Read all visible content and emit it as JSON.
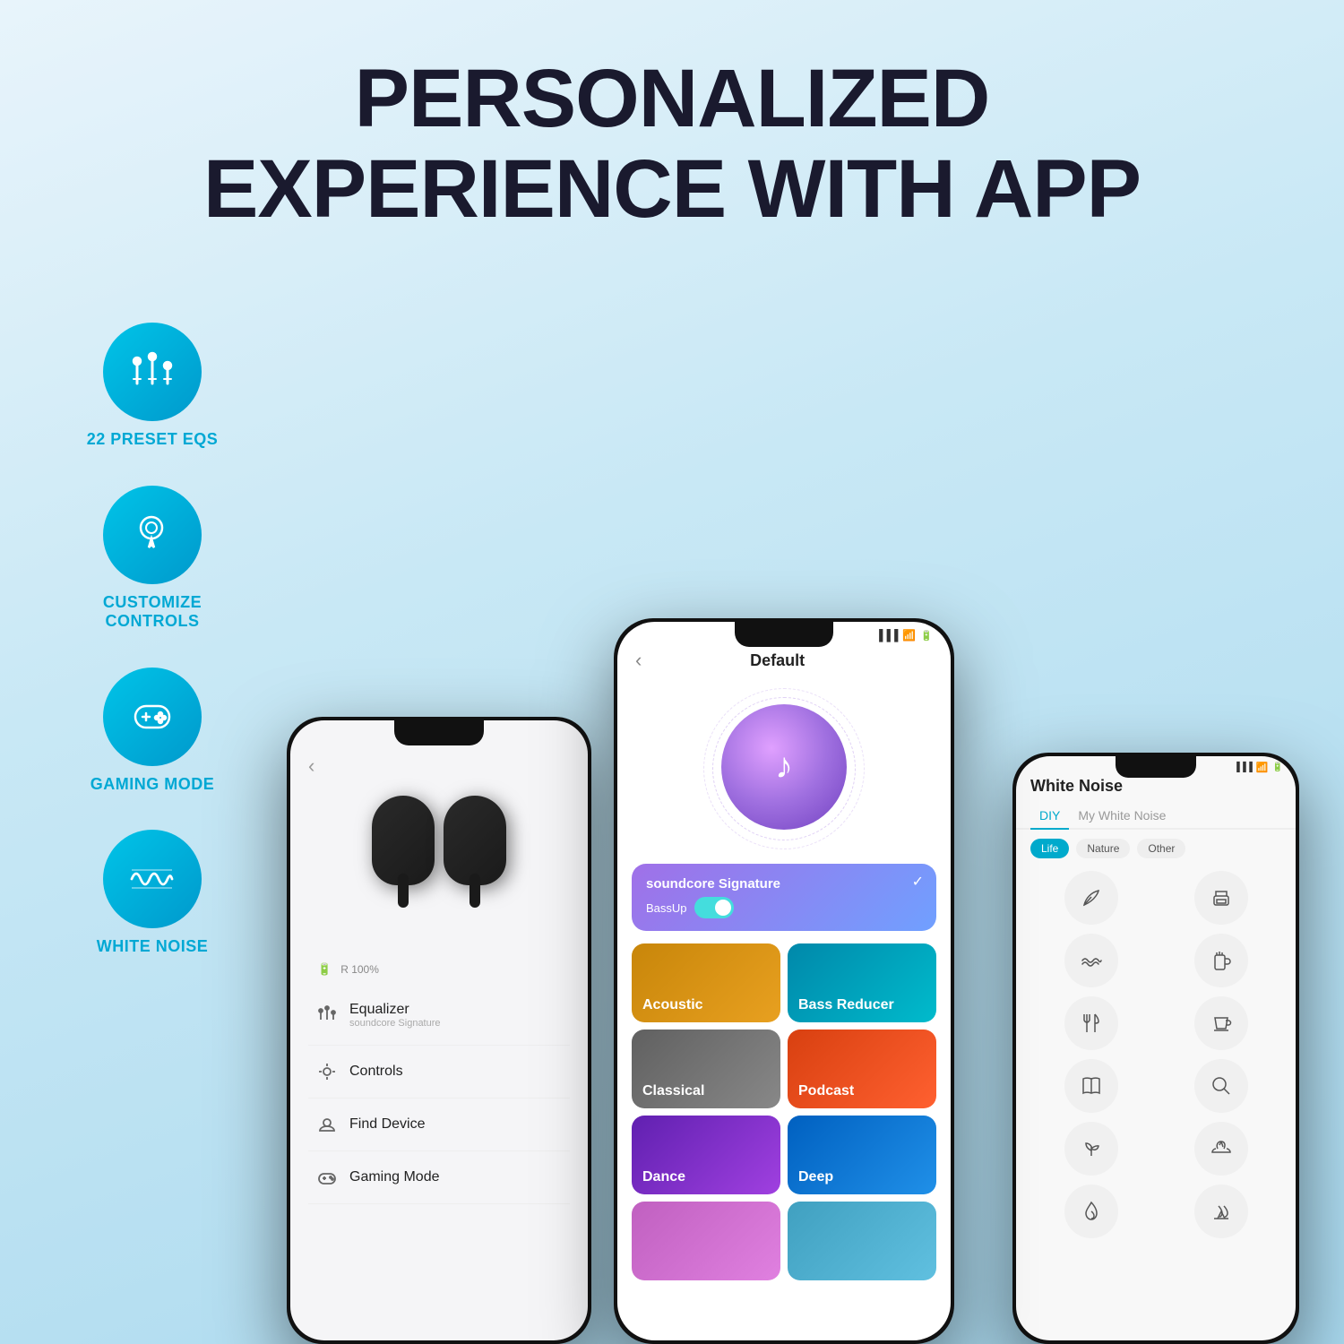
{
  "header": {
    "line1": "PERSONALIZED",
    "line2": "EXPERIENCE WITH APP"
  },
  "features": [
    {
      "id": "preset-eqs",
      "label": "22 PRESET EQS",
      "icon": "equalizer-icon"
    },
    {
      "id": "customize-controls",
      "label": "CUSTOMIZE\nCONTROLS",
      "icon": "touch-icon"
    },
    {
      "id": "gaming-mode",
      "label": "GAMING MODE",
      "icon": "gamepad-icon"
    },
    {
      "id": "white-noise",
      "label": "WHITE NOISE",
      "icon": "waveform-icon"
    }
  ],
  "left_phone": {
    "menu_items": [
      {
        "icon": "equalizer",
        "label": "Equalizer",
        "sub": "soundcore Signature"
      },
      {
        "icon": "controls",
        "label": "Controls",
        "sub": ""
      },
      {
        "icon": "find-device",
        "label": "Find Device",
        "sub": ""
      },
      {
        "icon": "gaming",
        "label": "Gaming Mode",
        "sub": ""
      }
    ]
  },
  "center_phone": {
    "title": "Default",
    "eq_active": "soundcore Signature",
    "bassup_label": "BassUp",
    "eq_tiles": [
      {
        "label": "Acoustic",
        "class": "eq-acoustic"
      },
      {
        "label": "Bass Reducer",
        "class": "eq-bass"
      },
      {
        "label": "Classical",
        "class": "eq-classical"
      },
      {
        "label": "Podcast",
        "class": "eq-podcast"
      },
      {
        "label": "Dance",
        "class": "eq-dance"
      },
      {
        "label": "Deep",
        "class": "eq-deep"
      },
      {
        "label": "",
        "class": "eq-partial"
      },
      {
        "label": "",
        "class": "eq-partial2"
      }
    ]
  },
  "right_phone": {
    "title": "White Noise",
    "tabs": [
      "DIY",
      "My White Noise"
    ],
    "sub_tabs": [
      "Life",
      "Nature",
      "Other"
    ],
    "active_tab": "DIY",
    "active_sub": "Life",
    "noise_icons": [
      "leaf",
      "printer",
      "waves",
      "beer",
      "fork-knife",
      "cup",
      "book",
      "search",
      "plant",
      "island",
      "fire",
      "fire2"
    ]
  }
}
